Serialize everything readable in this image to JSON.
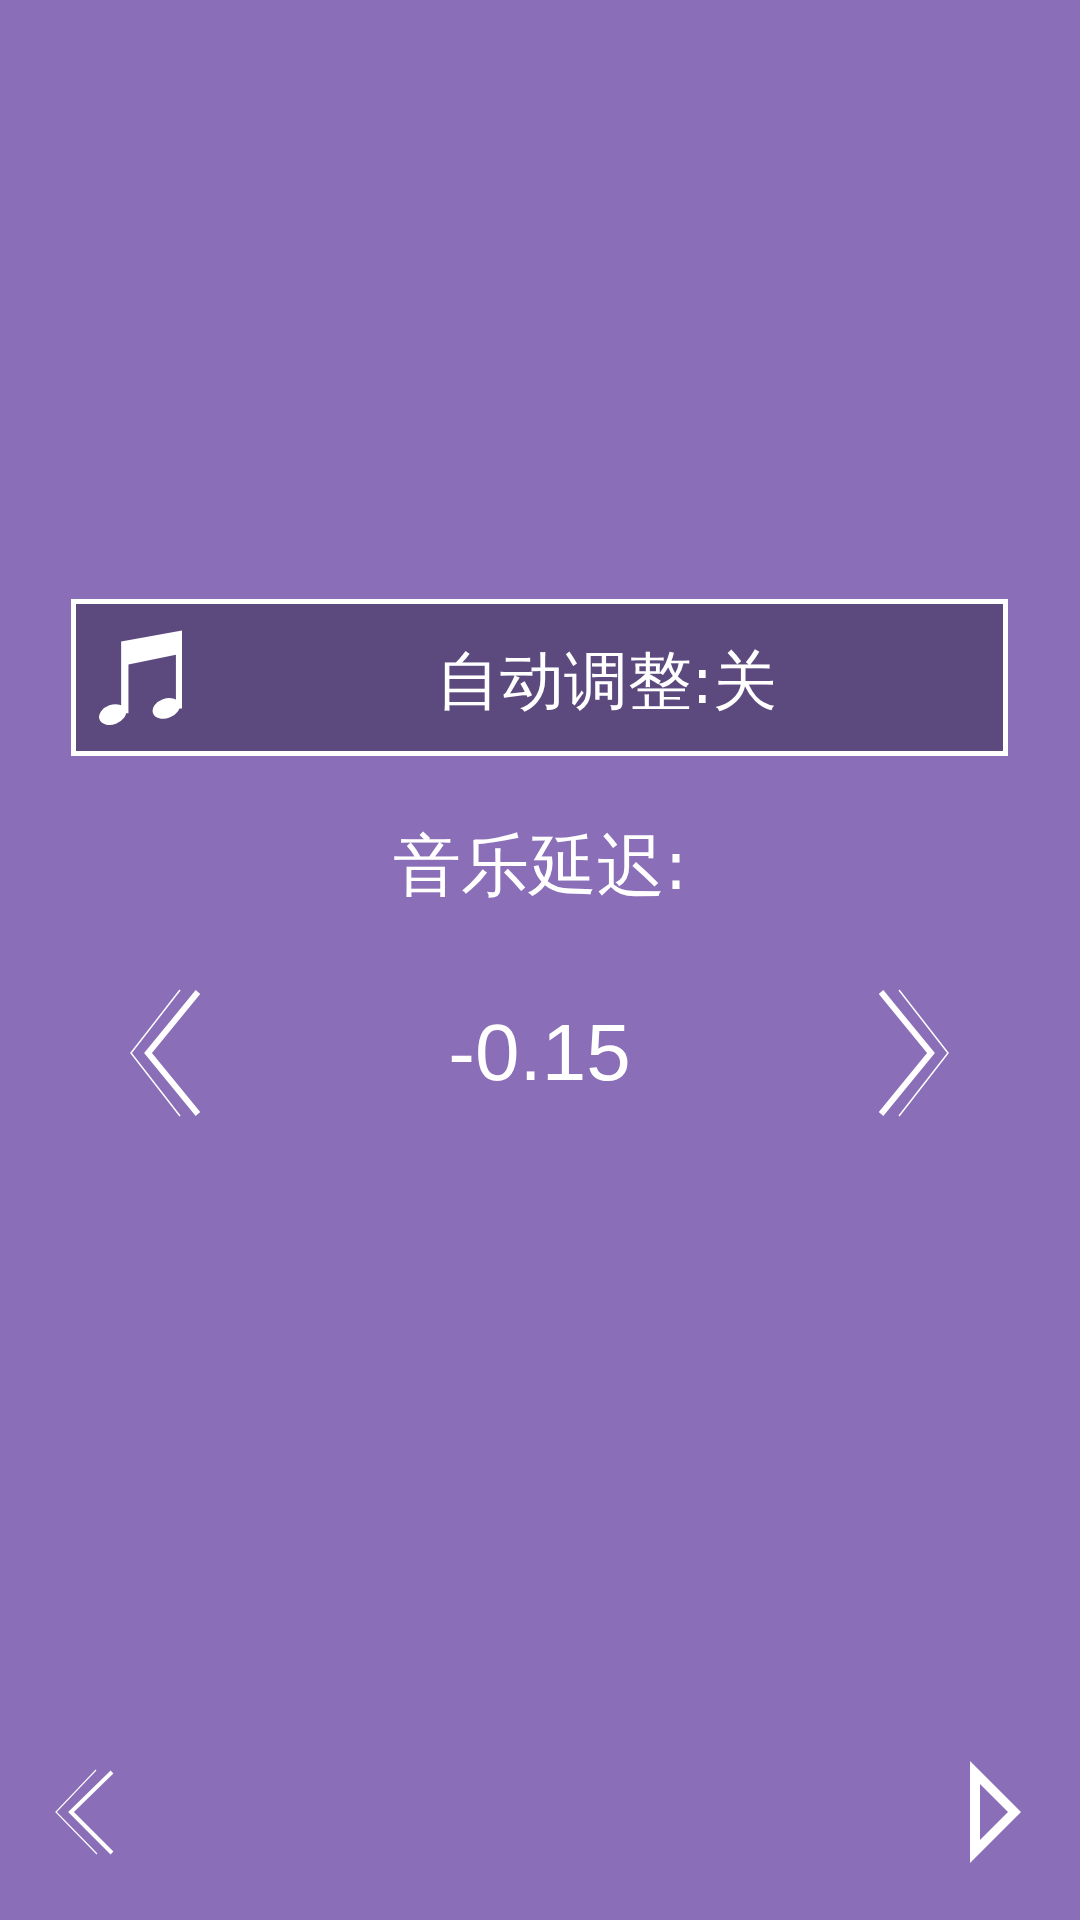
{
  "auto_adjust": {
    "label": "自动调整:关"
  },
  "music_delay": {
    "label": "音乐延迟:",
    "value": "-0.15"
  }
}
